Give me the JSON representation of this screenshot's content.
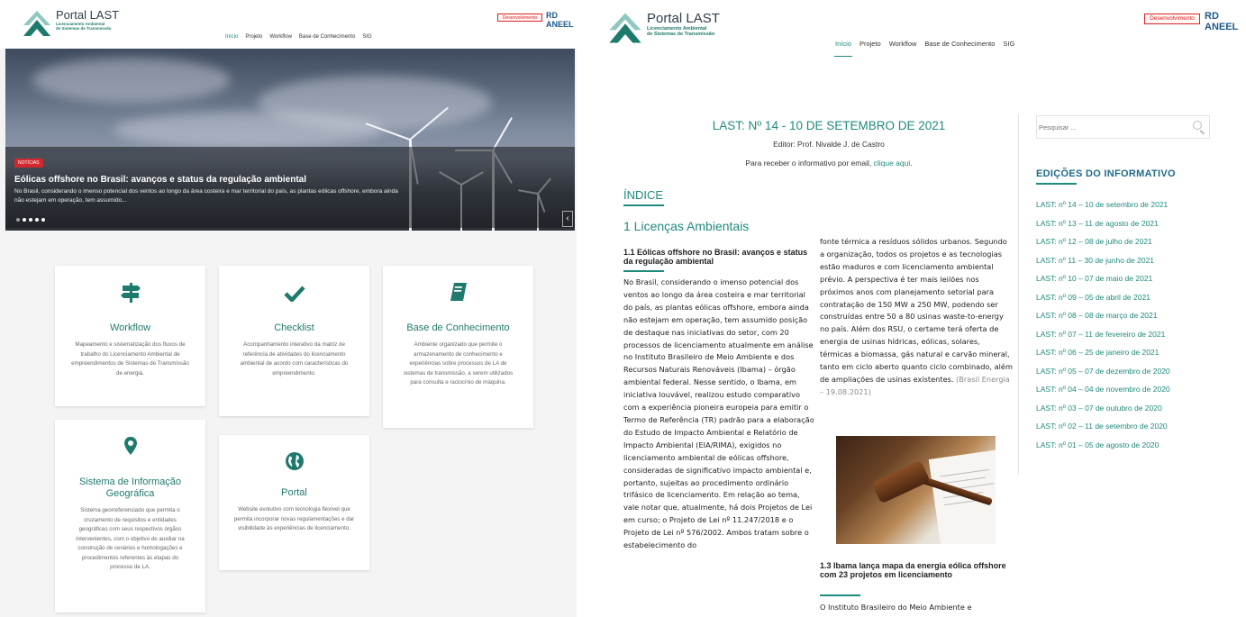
{
  "left": {
    "logo": {
      "title": "Portal LAST",
      "subtitle_line1": "Licenciamento Ambiental",
      "subtitle_line2": "de Sistemas de Transmissão"
    },
    "nav": [
      "Início",
      "Projeto",
      "Workflow",
      "Base de Conhecimento",
      "SIG"
    ],
    "badge": "Desenvolvimento",
    "partner": "RD ANEEL",
    "hero": {
      "tag": "NOTÍCIAS",
      "title": "Eólicas offshore no Brasil: avanços e status da regulação ambiental",
      "text": "No Brasil, considerando o imenso potencial dos ventos ao longo da área costeira e mar territorial do país, as plantas eólicas offshore, embora ainda não estejam em operação, tem assumido...",
      "arrow": "‹"
    },
    "cards": [
      {
        "icon": "signpost-icon",
        "title": "Workflow",
        "desc": "Mapeamento e sistematização dos fluxos de trabalho do Licenciamento Ambiental de empreendimentos de Sistemas de Transmissão de energia."
      },
      {
        "icon": "check-icon",
        "title": "Checklist",
        "desc": "Acompanhamento interativo da matriz de referência de atividades do licenciamento ambiental de acordo com características do empreendimento."
      },
      {
        "icon": "book-icon",
        "title": "Base de Conhecimento",
        "desc": "Ambiente organizado que permite o armazenamento de conhecimento e experiências sobre processos de LA de sistemas de transmissão, a serem utilizados para consulta e raciocínio de máquina."
      },
      {
        "icon": "map-marker-icon",
        "title": "Sistema de Informação Geográfica",
        "desc": "Sistema georreferenciado que permita o cruzamento de requisitos e entidades geográficas com seus respectivos órgãos intervenientes, com o objetivo de auxiliar na construção de cenários e homologações e procedimentos referentes às etapas do processo de LA."
      },
      {
        "icon": "globe-icon",
        "title": "Portal",
        "desc": "Website evolutivo com tecnologia flexível que permita incorporar novas regulamentações e dar visibilidade às experiências de licenciamento."
      }
    ]
  },
  "right": {
    "logo": {
      "title": "Portal LAST",
      "subtitle_line1": "Licenciamento Ambiental",
      "subtitle_line2": "de Sistemas de Transmissão"
    },
    "nav": [
      "Início",
      "Projeto",
      "Workflow",
      "Base de Conhecimento",
      "SIG"
    ],
    "badge": "Desenvolvimento",
    "partner": "RD ANEEL",
    "doc": {
      "title": "LAST: Nº 14 - 10 DE SETEMBRO DE 2021",
      "editor": "Editor: Prof. Nivalde J. de Castro",
      "mail_text": "Para receber o informativo por email, ",
      "mail_link": "clique aqui",
      "mail_end": ".",
      "indice": "ÍNDICE",
      "section": "1 Licenças Ambientais",
      "art1_title": "1.1 Eólicas offshore no Brasil: avanços e status da regulação ambiental",
      "art1_col1": "No Brasil, considerando o imenso potencial dos ventos ao longo da área costeira e mar territorial do país, as plantas eólicas offshore, embora ainda não estejam em operação, tem assumido posição de destaque nas iniciativas do setor, com 20 processos de licenciamento atualmente em análise no Instituto Brasileiro de Meio Ambiente e dos Recursos Naturais Renováveis (Ibama) – órgão ambiental federal. Nesse sentido, o Ibama, em iniciativa louvável, realizou estudo comparativo com a experiência pioneira europeia para emitir o Termo de Referência (TR) padrão para a elaboração do Estudo de Impacto Ambiental e Relatório de Impacto Ambiental (EIA/RIMA), exigidos no licenciamento ambiental de eólicas offshore, consideradas de significativo impacto ambiental e, portanto, sujeitas ao procedimento ordinário trifásico de licenciamento. Em relação ao tema, vale notar que, atualmente, há dois Projetos de Lei em curso; o Projeto de Lei nº 11.247/2018 e o Projeto de Lei nº 576/2002. Ambos tratam sobre o estabelecimento do",
      "art2_col2": "fonte térmica a resíduos sólidos urbanos. Segundo a organização, todos os projetos e as tecnologias estão maduros e com licenciamento ambiental prévio. A perspectiva é ter mais leilões nos próximos anos com planejamento setorial para contratação de 150 MW a 250 MW, podendo ser construídas entre 50 a 80 usinas waste-to-energy no país. Além dos RSU, o certame terá oferta de energia de usinas hídricas, eólicas, solares, térmicas a biomassa, gás natural e carvão mineral, tanto em ciclo aberto quanto ciclo combinado, além de ampliações de usinas existentes. ",
      "art2_source": "(Brasil Energia – 19.08.2021)",
      "art3_title": "1.3 Ibama lança mapa da energia eólica offshore com 23 projetos em licenciamento",
      "art3_start": "O Instituto Brasileiro do Meio Ambiente e"
    },
    "search_placeholder": "Pesquisar ...",
    "editions_title": "EDIÇÕES DO INFORMATIVO",
    "editions": [
      "LAST: nº 14 – 10 de setembro de 2021",
      "LAST: nº 13 – 11 de agosto de 2021",
      "LAST: nº 12 – 08 de julho de 2021",
      "LAST: nº 11 – 30 de junho de 2021",
      "LAST: nº 10 – 07 de maio de 2021",
      "LAST: nº 09 – 05 de abril de 2021",
      "LAST: nº 08 – 08 de março de 2021",
      "LAST: nº 07 – 11 de fevereiro de 2021",
      "LAST: nº 06 – 25 de janeiro de 2021",
      "LAST: nº 05 – 07 de dezembro de 2020",
      "LAST: nº 04 – 04 de novembro de 2020",
      "LAST: nº 03 – 07 de outubro de 2020",
      "LAST: nº 02 – 11 de setembro de 2020",
      "LAST: nº 01 – 05 de agosto de 2020"
    ]
  },
  "colors": {
    "accent": "#1f8a7d",
    "heading_blue": "#1f6a8a",
    "badge_red": "#d22222"
  }
}
